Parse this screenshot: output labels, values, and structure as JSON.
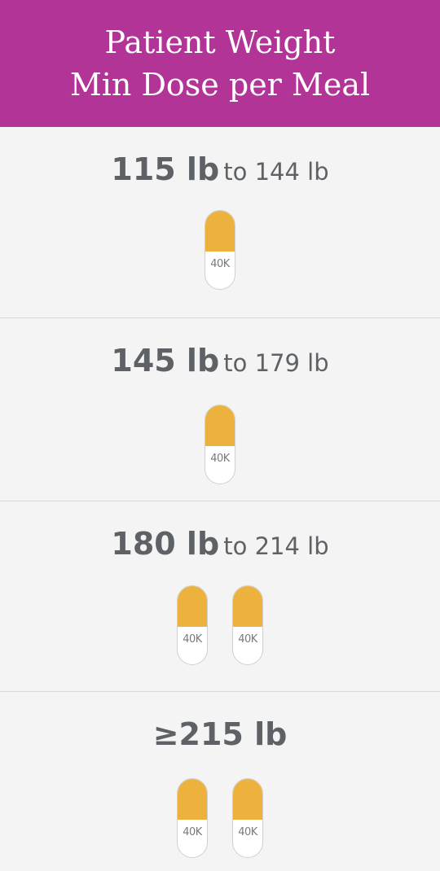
{
  "header": {
    "line1": "Patient Weight",
    "line2": "Min Dose per Meal"
  },
  "rows": [
    {
      "weight_bold": "115 lb",
      "weight_rest": "to 144 lb",
      "capsule_labels": [
        "40K"
      ]
    },
    {
      "weight_bold": "145 lb",
      "weight_rest": "to 179 lb",
      "capsule_labels": [
        "40K"
      ]
    },
    {
      "weight_bold": "180 lb",
      "weight_rest": "to 214 lb",
      "capsule_labels": [
        "40K",
        "40K"
      ]
    },
    {
      "weight_bold": "≥215 lb",
      "weight_rest": "",
      "capsule_labels": [
        "40K",
        "40K"
      ]
    }
  ],
  "colors": {
    "header_bg": "#b23496",
    "capsule_top": "#edb23e",
    "text": "#5e6266"
  },
  "icons": {
    "capsule": "capsule-icon"
  }
}
